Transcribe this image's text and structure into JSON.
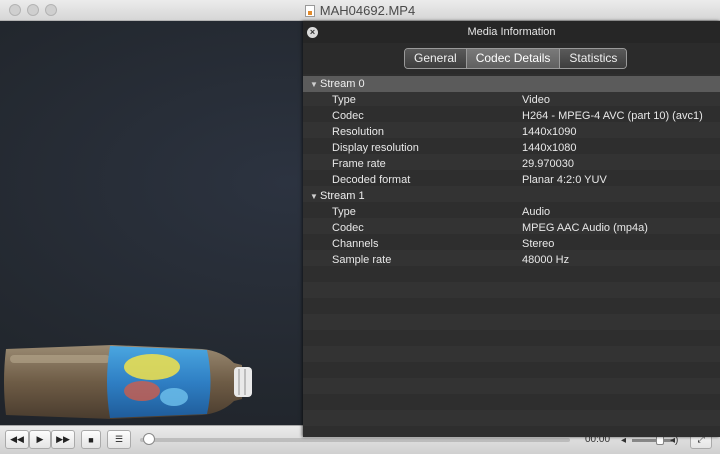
{
  "window": {
    "title": "MAH04692.MP4"
  },
  "panel": {
    "title": "Media Information",
    "tabs": [
      {
        "label": "General"
      },
      {
        "label": "Codec Details"
      },
      {
        "label": "Statistics"
      }
    ],
    "streams": [
      {
        "name": "Stream 0",
        "rows": [
          {
            "key": "Type",
            "value": "Video"
          },
          {
            "key": "Codec",
            "value": "H264 - MPEG-4 AVC (part 10) (avc1)"
          },
          {
            "key": "Resolution",
            "value": "1440x1090"
          },
          {
            "key": "Display resolution",
            "value": "1440x1080"
          },
          {
            "key": "Frame rate",
            "value": "29.970030"
          },
          {
            "key": "Decoded format",
            "value": "Planar 4:2:0 YUV"
          }
        ]
      },
      {
        "name": "Stream 1",
        "rows": [
          {
            "key": "Type",
            "value": "Audio"
          },
          {
            "key": "Codec",
            "value": "MPEG AAC Audio (mp4a)"
          },
          {
            "key": "Channels",
            "value": "Stereo"
          },
          {
            "key": "Sample rate",
            "value": "48000 Hz"
          }
        ]
      }
    ]
  },
  "controls": {
    "rewind_icon": "◀◀",
    "play_icon": "▶",
    "forward_icon": "▶▶",
    "stop_icon": "■",
    "playlist_icon": "☰",
    "elapsed": "00:00",
    "fullscreen_icon": "⤢"
  }
}
